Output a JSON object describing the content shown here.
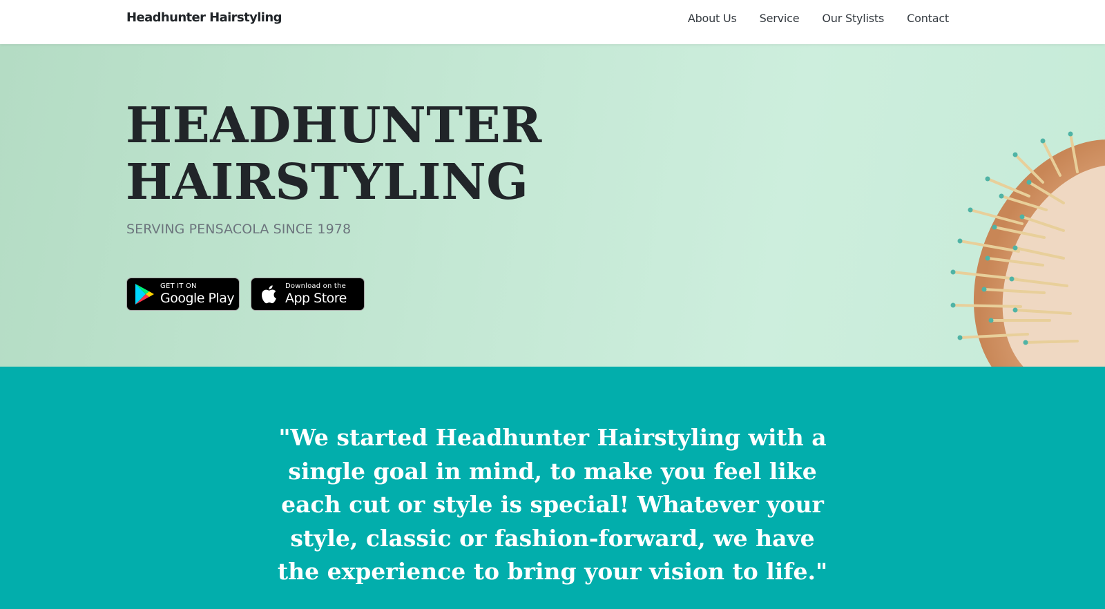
{
  "navbar": {
    "brand": "Headhunter Hairstyling",
    "links": [
      {
        "label": "About Us"
      },
      {
        "label": "Service"
      },
      {
        "label": "Our Stylists"
      },
      {
        "label": "Contact"
      }
    ]
  },
  "hero": {
    "title_line1": "HEADHUNTER",
    "title_line2": "HAIRSTYLING",
    "subtitle": "SERVING PENSACOLA SINCE 1978",
    "badges": {
      "google": {
        "small": "GET IT ON",
        "big": "Google Play"
      },
      "apple": {
        "small": "Download on the",
        "big": "App Store"
      }
    }
  },
  "quote": {
    "text": "\"We started Headhunter Hairstyling with a single goal in mind, to make you feel like each cut or style is special! Whatever your style, classic or fashion-forward, we have the experience to bring your vision to life.\""
  },
  "colors": {
    "quote_bg": "#02aeac",
    "hero_bg": "#c3e7d3",
    "text_dark": "#212529",
    "text_muted": "#6c757d"
  }
}
